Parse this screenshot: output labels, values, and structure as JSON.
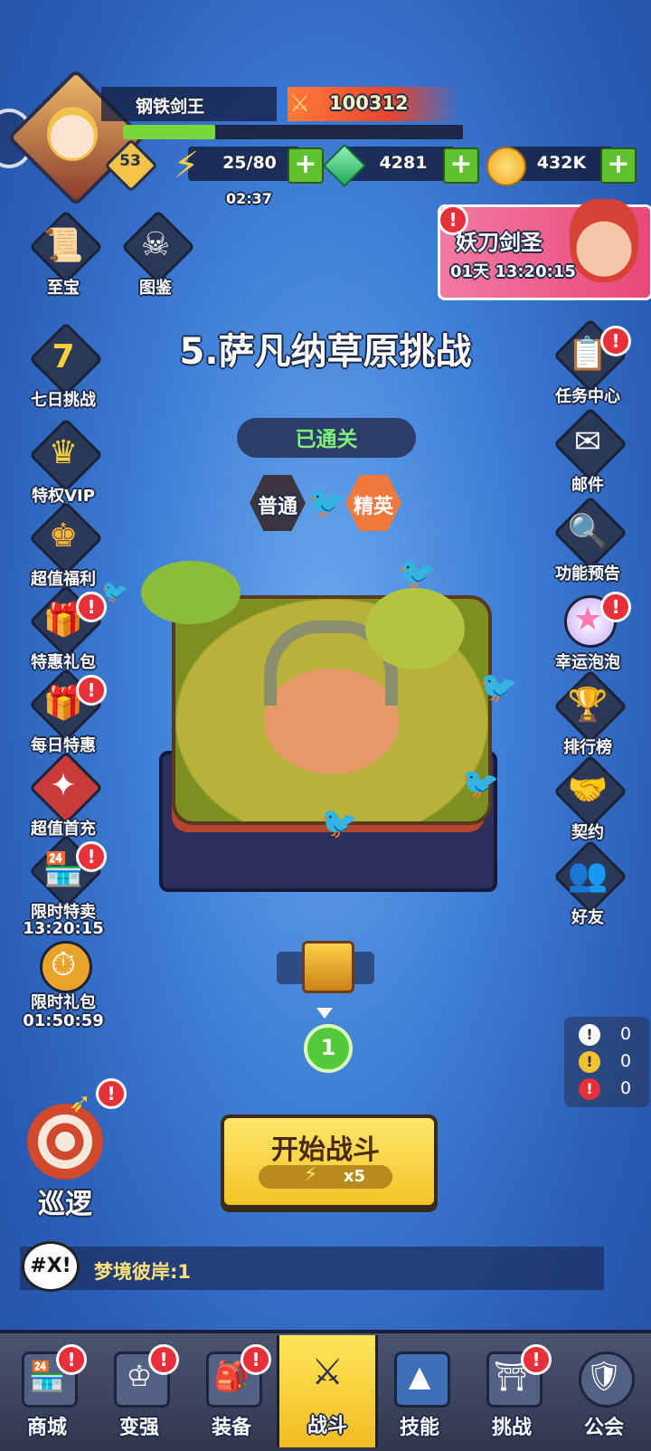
{
  "player": {
    "name": "钢铁剑王",
    "level": "53",
    "power": "100312",
    "xp_fraction": 0.27
  },
  "resources": {
    "energy": "25/80",
    "energy_timer": "02:37",
    "gems": "4281",
    "gold": "432K"
  },
  "event_banner": {
    "title": "妖刀剑圣",
    "countdown": "01天 13:20:15"
  },
  "left_menu": [
    {
      "label": "至宝",
      "icon": "scroll-icon",
      "badge": false
    },
    {
      "label": "七日挑战",
      "icon": "seven-icon",
      "badge": false
    },
    {
      "label": "特权VIP",
      "icon": "crown-icon",
      "badge": false
    },
    {
      "label": "超值福利",
      "icon": "crown-chest-icon",
      "badge": false
    },
    {
      "label": "特惠礼包",
      "icon": "gift-icon",
      "badge": true
    },
    {
      "label": "每日特惠",
      "icon": "gift-icon",
      "badge": true
    },
    {
      "label": "超值首充",
      "icon": "first-recharge-icon",
      "badge": false
    },
    {
      "label": "限时特卖",
      "sub": "13:20:15",
      "icon": "shop-icon",
      "badge": true
    },
    {
      "label": "限时礼包",
      "sub": "01:50:59",
      "icon": "stopwatch-icon",
      "badge": false
    }
  ],
  "codex": {
    "label": "图鉴",
    "icon": "skull-card-icon"
  },
  "right_menu": [
    {
      "label": "任务中心",
      "icon": "task-icon",
      "badge": true
    },
    {
      "label": "邮件",
      "icon": "mail-icon",
      "badge": false
    },
    {
      "label": "功能预告",
      "icon": "magnifier-book-icon",
      "badge": false
    },
    {
      "label": "幸运泡泡",
      "icon": "bubble-icon",
      "badge": true
    },
    {
      "label": "排行榜",
      "icon": "trophy-icon",
      "badge": false
    },
    {
      "label": "契约",
      "icon": "handshake-icon",
      "badge": false
    },
    {
      "label": "好友",
      "icon": "friends-icon",
      "badge": false
    }
  ],
  "stage": {
    "title": "5.萨凡纳草原挑战",
    "status": "已通关",
    "mode_normal": "普通",
    "mode_elite": "精英",
    "progress_step": "1"
  },
  "counters": [
    {
      "icon": "info-icon",
      "value": "0",
      "color": "#ffffff"
    },
    {
      "icon": "warning-icon",
      "value": "0",
      "color": "#f2c230"
    },
    {
      "icon": "alert-icon",
      "value": "0",
      "color": "#e8303a"
    }
  ],
  "patrol": {
    "label": "巡逻"
  },
  "start_button": {
    "label": "开始战斗",
    "cost": "x5"
  },
  "chat": {
    "icon_text": "#X!",
    "message": "梦境彼岸:1"
  },
  "nav": [
    {
      "label": "商城",
      "icon": "shop-icon",
      "badge": true,
      "active": false
    },
    {
      "label": "变强",
      "icon": "chest-icon",
      "badge": true,
      "active": false
    },
    {
      "label": "装备",
      "icon": "backpack-icon",
      "badge": true,
      "active": false
    },
    {
      "label": "战斗",
      "icon": "swords-icon",
      "badge": false,
      "active": true
    },
    {
      "label": "技能",
      "icon": "spellbook-icon",
      "badge": false,
      "active": false
    },
    {
      "label": "挑战",
      "icon": "gate-icon",
      "badge": true,
      "active": false
    },
    {
      "label": "公会",
      "icon": "guild-shield-icon",
      "badge": false,
      "active": false
    }
  ]
}
